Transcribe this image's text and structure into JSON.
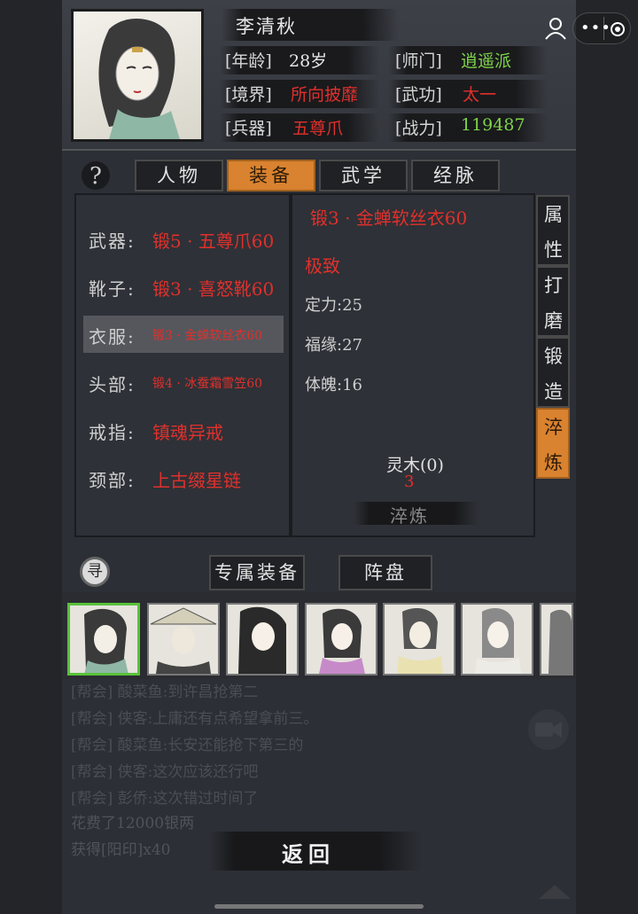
{
  "character": {
    "name": "李清秋",
    "stats": [
      {
        "label": "[年龄]",
        "value": "28岁",
        "color": "#e6e6e6"
      },
      {
        "label": "[师门]",
        "value": "逍遥派",
        "color": "#7fd44a"
      },
      {
        "label": "[境界]",
        "value": "所向披靡",
        "color": "#e0302c"
      },
      {
        "label": "[武功]",
        "value": "太一",
        "color": "#e0302c"
      },
      {
        "label": "[兵器]",
        "value": "五尊爪",
        "color": "#e0302c"
      },
      {
        "label": "[战力]",
        "value": "119487",
        "color": "#7fd44a"
      }
    ]
  },
  "tabs": [
    "人物",
    "装备",
    "武学",
    "经脉"
  ],
  "active_tab": "装备",
  "equipment": [
    {
      "slot": "武器:",
      "item": "锻5 · 五尊爪60"
    },
    {
      "slot": "靴子:",
      "item": "锻3 · 喜怒靴60"
    },
    {
      "slot": "衣服:",
      "item": "锻3 · 金蝉软丝衣60"
    },
    {
      "slot": "头部:",
      "item": "锻4 · 冰蚕霜雪笠60"
    },
    {
      "slot": "戒指:",
      "item": "镇魂异戒"
    },
    {
      "slot": "颈部:",
      "item": "上古缀星链"
    }
  ],
  "detail": {
    "item_name": "锻3 · 金蝉软丝衣60",
    "quality": "极致",
    "attrs": [
      "定力:25",
      "福缘:27",
      "体魄:16"
    ],
    "material": "灵木(0)",
    "cost": "3",
    "action_label": "淬炼"
  },
  "side_tabs": [
    "属性",
    "打磨",
    "锻造",
    "淬炼"
  ],
  "active_side_tab": "淬炼",
  "bottom_tabs": [
    "专属装备",
    "阵盘"
  ],
  "search_icon_glyph": "寻",
  "help_glyph": "?",
  "chat": [
    "[帮会] 酸菜鱼:到许昌抢第二",
    "[帮会] 侠客:上庸还有点希望拿前三。",
    "[帮会] 酸菜鱼:长安还能抢下第三的",
    "[帮会] 侠客:这次应该还行吧",
    "[帮会] 彭侨:这次错过时间了",
    "花费了12000银两",
    "获得[阳印]x40"
  ],
  "back_label": "返回",
  "colors": {
    "accent": "#d9822f",
    "red": "#e0302c",
    "green": "#7fd44a"
  }
}
